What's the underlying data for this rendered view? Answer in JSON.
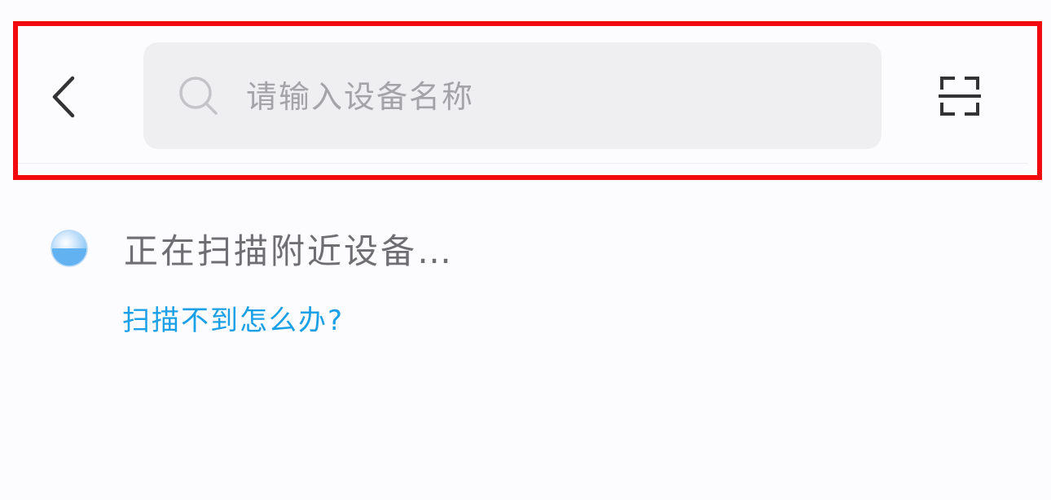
{
  "header": {
    "back_icon": "chevron-left-icon",
    "search": {
      "placeholder": "请输入设备名称",
      "value": "",
      "icon": "search-icon"
    },
    "scan_icon": "scan-frame-icon"
  },
  "scan_status": {
    "icon": "spinner-icon",
    "text": "正在扫描附近设备…"
  },
  "help_link": {
    "label": "扫描不到怎么办?"
  },
  "colors": {
    "highlight_border": "#f20a10",
    "link": "#1aa0e6",
    "search_bg": "#efeff1",
    "spinner": "#4aa8f0"
  }
}
